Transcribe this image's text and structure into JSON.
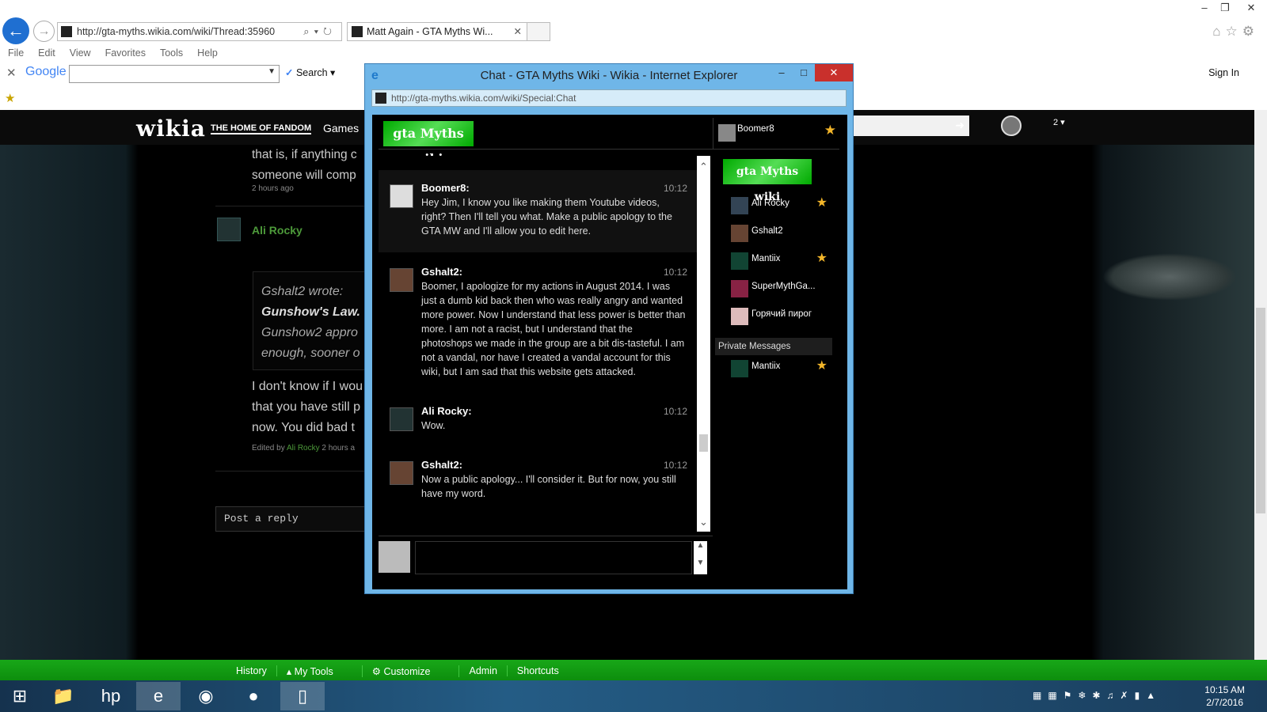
{
  "browser": {
    "address": "http://gta-myths.wikia.com/wiki/Thread:35960",
    "tab_title": "Matt Again - GTA Myths Wi...",
    "menu": [
      "File",
      "Edit",
      "View",
      "Favorites",
      "Tools",
      "Help"
    ],
    "google_label": "Google",
    "search_label": "Search",
    "sign_in": "Sign In"
  },
  "wiki": {
    "logo": "wikia",
    "tagline": "THE HOME OF FANDOM",
    "nav_games": "Games",
    "thread_text_1": "that is, if anything c",
    "thread_text_2": "someone will comp",
    "timestamp": "2 hours ago",
    "reply_author": "Ali Rocky",
    "quote_author": "Gshalt2 wrote:",
    "quote_title": "Gunshow's Law.",
    "quote_line_1": "Gunshow2 appro",
    "quote_line_2": "enough, sooner o",
    "body_1": "I don't know if I wou",
    "body_2": "that you have still p",
    "body_3": "now. You did bad t",
    "edited_by": "Edited by",
    "edited_name": "Ali Rocky",
    "edited_time": "2 hours a",
    "post_reply": "Post a reply",
    "notif_count": "2"
  },
  "toolbar": {
    "history": "History",
    "my_tools": "My Tools",
    "customize": "Customize",
    "admin": "Admin",
    "shortcuts": "Shortcuts"
  },
  "taskbar": {
    "time": "10:15 AM",
    "date": "2/7/2016"
  },
  "popup": {
    "title": "Chat - GTA Myths Wiki - Wikia - Internet Explorer",
    "url": "http://gta-myths.wikia.com/wiki/Special:Chat",
    "logo_text": "gta Myths wiki",
    "current_user": "Boomer8",
    "messages": [
      {
        "name": "Boomer8:",
        "time": "10:12",
        "text": "Hey Jim, I know you like making them Youtube videos, right? Then I'll tell you what. Make a public apology to the GTA MW and I'll allow you to edit here."
      },
      {
        "name": "Gshalt2:",
        "time": "10:12",
        "text": "Boomer, I apologize for my actions in August 2014. I was just a dumb kid back then who was really angry and wanted more power. Now I understand that less power is better than more. I am not a racist, but I understand that the photoshops we made in the group are a bit dis-tasteful. I am not a vandal, nor have I created a vandal account for this wiki, but I am sad that this website gets attacked."
      },
      {
        "name": "Ali Rocky:",
        "time": "10:12",
        "text": "Wow."
      },
      {
        "name": "Gshalt2:",
        "time": "10:12",
        "text": "Now a public apology... I'll consider it. But for now, you still have my word."
      }
    ],
    "users": [
      "Ali Rocky",
      "Gshalt2",
      "Mantiix",
      "SuperMythGa...",
      "Горячий пирог"
    ],
    "private_messages_label": "Private Messages",
    "private_users": [
      "Mantiix"
    ]
  }
}
